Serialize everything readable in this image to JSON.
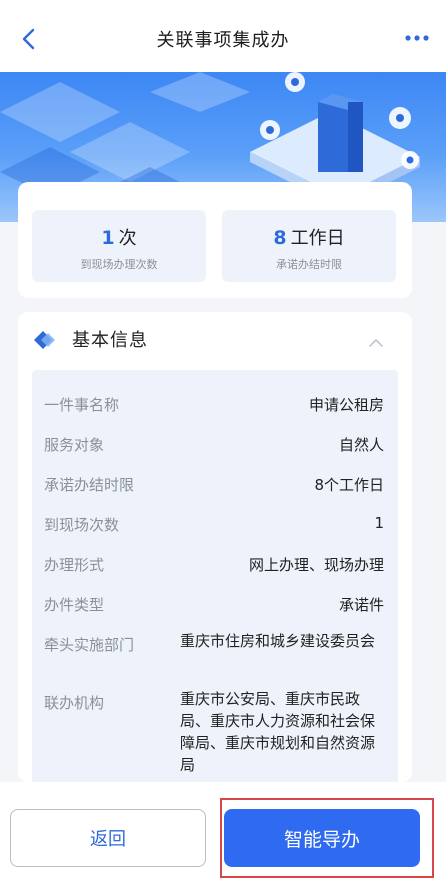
{
  "header": {
    "title": "关联事项集成办",
    "back_icon": "chevron-left-icon",
    "more_icon": "more-dots-icon"
  },
  "stats": [
    {
      "value": "1",
      "unit": "次",
      "label": "到现场办理次数"
    },
    {
      "value": "8",
      "unit": "工作日",
      "label": "承诺办结时限"
    }
  ],
  "info": {
    "section_title": "基本信息",
    "rows": [
      {
        "label": "一件事名称",
        "value": "申请公租房"
      },
      {
        "label": "服务对象",
        "value": "自然人"
      },
      {
        "label": "承诺办结时限",
        "value": "8个工作日"
      },
      {
        "label": "到现场次数",
        "value": "1"
      },
      {
        "label": "办理形式",
        "value": "网上办理、现场办理"
      },
      {
        "label": "办件类型",
        "value": "承诺件"
      },
      {
        "label": "牵头实施部门",
        "value": "重庆市住房和城乡建设委员会"
      },
      {
        "label": "联办机构",
        "value": "重庆市公安局、重庆市民政局、重庆市人力资源和社会保障局、重庆市规划和自然资源局"
      }
    ]
  },
  "buttons": {
    "back_label": "返回",
    "guide_label": "智能导办"
  },
  "colors": {
    "accent": "#2f6bf0",
    "highlight_frame": "#d84747",
    "info_bg": "#eef3fb"
  }
}
